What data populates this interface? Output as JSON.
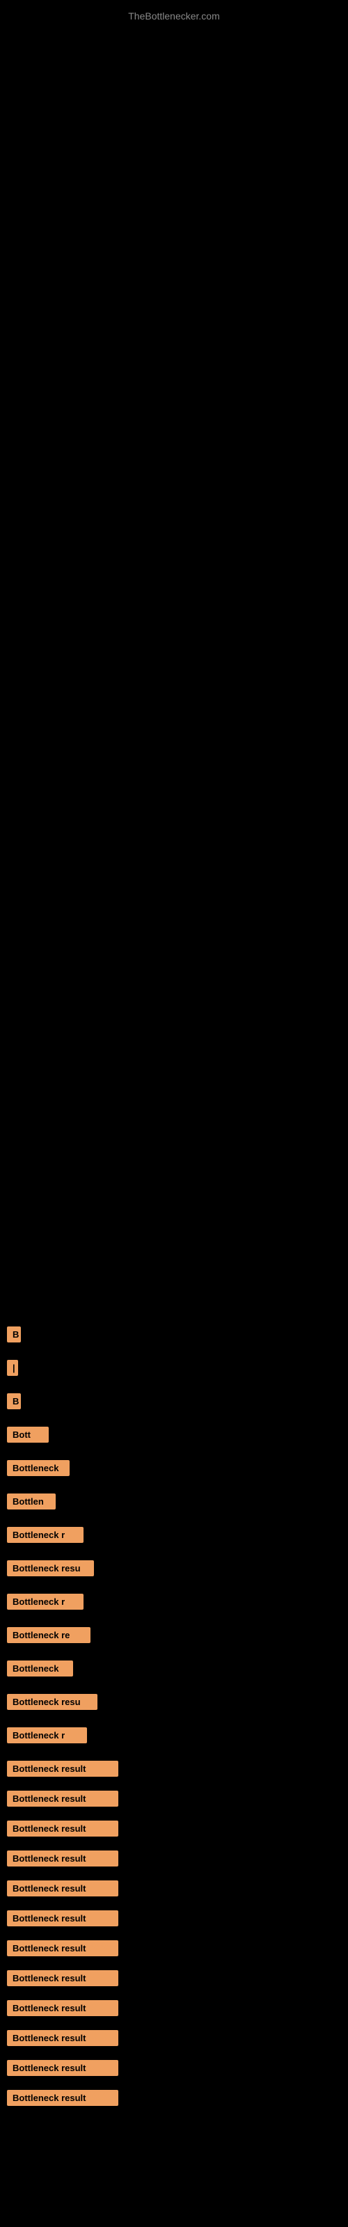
{
  "site": {
    "title": "TheBottlenecker.com"
  },
  "items": [
    {
      "id": 1,
      "label": "B",
      "cssClass": "item-1"
    },
    {
      "id": 2,
      "label": "|",
      "cssClass": "item-2"
    },
    {
      "id": 3,
      "label": "B",
      "cssClass": "item-3"
    },
    {
      "id": 4,
      "label": "Bott",
      "cssClass": "item-4"
    },
    {
      "id": 5,
      "label": "Bottleneck",
      "cssClass": "item-5"
    },
    {
      "id": 6,
      "label": "Bottlen",
      "cssClass": "item-6"
    },
    {
      "id": 7,
      "label": "Bottleneck r",
      "cssClass": "item-7"
    },
    {
      "id": 8,
      "label": "Bottleneck resu",
      "cssClass": "item-8"
    },
    {
      "id": 9,
      "label": "Bottleneck r",
      "cssClass": "item-9"
    },
    {
      "id": 10,
      "label": "Bottleneck re",
      "cssClass": "item-10"
    },
    {
      "id": 11,
      "label": "Bottleneck",
      "cssClass": "item-11"
    },
    {
      "id": 12,
      "label": "Bottleneck resu",
      "cssClass": "item-12"
    },
    {
      "id": 13,
      "label": "Bottleneck r",
      "cssClass": "item-13"
    },
    {
      "id": 14,
      "label": "Bottleneck result",
      "cssClass": "item-14"
    },
    {
      "id": 15,
      "label": "Bottleneck result",
      "cssClass": "item-15"
    },
    {
      "id": 16,
      "label": "Bottleneck result",
      "cssClass": "item-16"
    },
    {
      "id": 17,
      "label": "Bottleneck result",
      "cssClass": "item-17"
    },
    {
      "id": 18,
      "label": "Bottleneck result",
      "cssClass": "item-18"
    },
    {
      "id": 19,
      "label": "Bottleneck result",
      "cssClass": "item-19"
    },
    {
      "id": 20,
      "label": "Bottleneck result",
      "cssClass": "item-20"
    },
    {
      "id": 21,
      "label": "Bottleneck result",
      "cssClass": "item-21"
    },
    {
      "id": 22,
      "label": "Bottleneck result",
      "cssClass": "item-22"
    },
    {
      "id": 23,
      "label": "Bottleneck result",
      "cssClass": "item-23"
    },
    {
      "id": 24,
      "label": "Bottleneck result",
      "cssClass": "item-24"
    },
    {
      "id": 25,
      "label": "Bottleneck result",
      "cssClass": "item-25"
    }
  ]
}
